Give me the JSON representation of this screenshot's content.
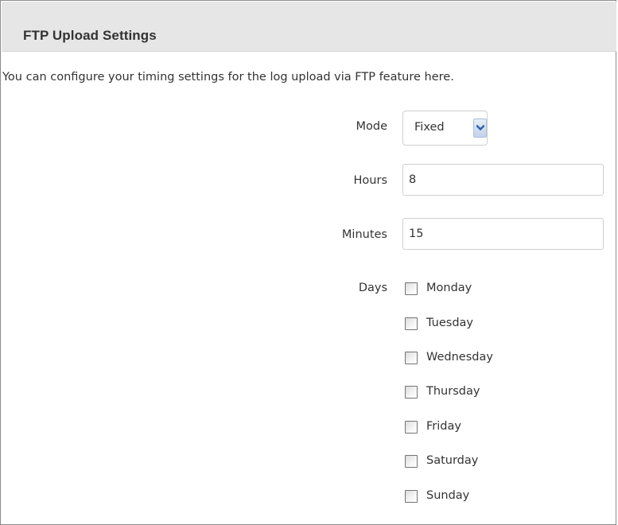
{
  "panel": {
    "title": "FTP Upload Settings",
    "description": "You can configure your timing settings for the log upload via FTP feature here."
  },
  "form": {
    "mode": {
      "label": "Mode",
      "selected": "Fixed"
    },
    "hours": {
      "label": "Hours",
      "value": "8"
    },
    "minutes": {
      "label": "Minutes",
      "value": "15"
    },
    "days": {
      "label": "Days",
      "options": [
        {
          "label": "Monday",
          "checked": false
        },
        {
          "label": "Tuesday",
          "checked": false
        },
        {
          "label": "Wednesday",
          "checked": false
        },
        {
          "label": "Thursday",
          "checked": false
        },
        {
          "label": "Friday",
          "checked": false
        },
        {
          "label": "Saturday",
          "checked": false
        },
        {
          "label": "Sunday",
          "checked": false
        }
      ]
    }
  },
  "colors": {
    "header_background": "#e6e6e6",
    "text": "#333333",
    "border": "#8c8c8c",
    "select_arrow": "#2f5fae"
  },
  "icons": {
    "select_arrow": "chevron-down-icon"
  }
}
